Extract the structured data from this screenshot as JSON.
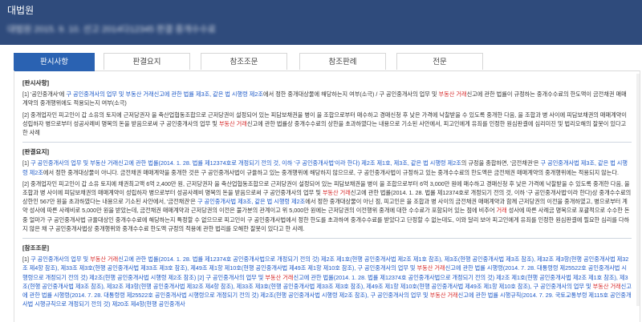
{
  "header": {
    "title": "대법원",
    "subtitle": "대법원 2015. 9. 10. 선고 2014다12345 판결 중개수수료"
  },
  "tabs": [
    {
      "label": "판시사항",
      "active": true
    },
    {
      "label": "판결요지",
      "active": false
    },
    {
      "label": "참조조문",
      "active": false
    },
    {
      "label": "참조판례",
      "active": false
    },
    {
      "label": "전문",
      "active": false
    }
  ],
  "sections": {
    "s1": {
      "title": "[판시사항]",
      "p1": [
        "[1] '공인중개사'에 ",
        "구 공인중개사의 업무 및 부동산 거래신고에 관한 법률 제3조, 같은 법 시행령 제2조",
        "에서 정한 중개대상물에 해당하는지 여부(소극) / 구 공인중개사의 업무 및 ",
        "부동산 거래",
        "신고에 관한 법률이 규정하는 중개수수료의 한도액이 금전채권 매매계약의 중개행위에도 적용되는지 여부(소극)"
      ],
      "p2": [
        "[2] 중개업자인 피고인이 갑 소유의 토지에 근저당권자 을 축산업협동조합으로 근저당권이 설정되어 있는 피담보채권을 병이 을 조합으로부터 매수하고 경매신청 후 낮은 가격에 낙찰받을 수 있도록 중개한 다음, 을 조합과 병 사이에 피담보채권의 매매계약이 성립하자 병으로부터 성공사례비 명목의 돈을 받음으로써 구 공인중개사의 업무 및 ",
        "부동산 거래",
        "신고에 관한 법률상 중개수수료의 상한을 초과하였다는 내용으로 기소된 사안에서, 피고인에게 유죄를 인정한 원심판결에 심리미진 및 법리오해의 잘못이 있다고 한 사례"
      ]
    },
    "s2": {
      "title": "[판결요지]",
      "p1": [
        "[1] ",
        "구 공인중개사의 업무 및 부동산 거래신고에 관한 법률(2014. 1. 28. 법률 제12374호로 개정되기 전의 것, 이하 '구 공인중개사법'이라 한다) 제2조 제1호, 제3조, 같은 법 시행령 제2조",
        "의 규정을 종합하면, '금전채권'은 ",
        "구 공인중개사법 제3조, 같은 법 시행령 제2조",
        "에서 정한 중개대상물이 아니다. 금전채권 매매계약을 중개한 것은 구 공인중개사법이 규율하고 있는 중개행위에 해당하지 않으므로, 구 공인중개사법이 규정하고 있는 중개수수료의 한도액은 금전채권 매매계약의 중개행위에는 적용되지 않는다."
      ],
      "p2": [
        "[2] 중개업자인 피고인이 갑 소유 토지에 채권최고액 6억 2,400만 원, 근저당권자 을 축산업협동조합으로 근저당권이 설정되어 있는 피담보채권을 병이 을 조합으로부터 6억 3,000만 원에 매수하고 경매신청 후 낮은 가격에 낙찰받을 수 있도록 중개한 다음, 을 조합과 병 사이에 피담보채권의 매매계약이 성립하자 병으로부터 성공사례비 명목의 돈을 받음으로써 구 공인중개사의 업무 및 ",
        "부동산 거래",
        "신고에 관한 법률(2014. 1. 28. 법률 제12374호로 개정되기 전의 것, 이하 '구 공인중개사법'이라 한다)상 중개수수료의 상한인 567만 원을 초과하였다는 내용으로 기소된 사안에서, '금전채권'은 ",
        "구 공인중개사법 제3조, 같은 법 시행령 제2조",
        "에서 정한 중개대상물이 아닌 점, 피고인은 을 조합과 병 사이의 금전채권 매매계약과 함께 근저당권의 이전을 중개하였고, 병으로부터 계약 성사에 따른 사례비로 5,000만 원을 받았는데, 금전채권 매매계약과 근저당권의 이전은 불가분의 관계이고 위 5,000만 원에는 근저당권의 이전행위 중개에 대한 수수료가 포함되어 있는 점에 비추어 ",
        "거래",
        " 성사에 따른 사례금 명목으로 포괄적으로 수수한 돈 중 얼마가 구 공인중개사법 규율대상인 중개수수료에 해당하는지 특정할 수 없으므로 피고인이 구 공인중개사법에서 정한 한도를 초과하여 중개수수료를 받았다고 단정할 수 없는데도, 이와 달리 보아 피고인에게 유죄를 인정한 원심판결에 필요한 심리를 다하지 않은 채 구 공인중개사법상 중개행위와 중개수수료 한도액 규정의 적용에 관한 법리를 오해한 잘못이 있다고 한 사례."
      ]
    },
    "s3": {
      "title": "[참조조문]",
      "p1": [
        "[1] ",
        "구 공인중개사의 업무 및 ",
        "부동산 거래",
        "신고에 관한 법률(2014. 1. 28. 법률 제12374호 공인중개사법으로 개정되기 전의 것) 제2조 제1호(현행 공인중개사법 제2조 제1호 참조), 제3조(현행 공인중개사법 제3조 참조), 제32조 제3항(현행 공인중개사법 제32조 제4항 참조), 제33조 제3호(현행 공인중개사법 제33조 제3호 참조), 제49조 제1항 제10호(현행 공인중개사법 제49조 제1항 제10호 참조), 구 공인중개사의 업무 및 ",
        "부동산 거래",
        "신고에 관한 법률 시행령(2014. 7. 28. 대통령령 제25522호 공인중개사법 시행령으로 개정되기 전의 것) 제2조(현행 공인중개사법 시행령 제2조 참조) [2] 구 공인중개사의 업무 및 ",
        "부동산 거래",
        "신고에 관한 법률(2014. 1. 28. 법률 제12374호 공인중개사법으로 개정되기 전의 것) 제2조 제1호(현행 공인중개사법 제2조 제1호 참조), 제3조(현행 공인중개사법 제3조 참조), 제32조 제3항(현행 공인중개사법 제32조 제4항 참조), 제33조 제3호(현행 공인중개사법 제33조 제3호 참조), 제49조 제1항 제10호(현행 공인중개사법 제49조 제1항 제10호 참조), 구 공인중개사의 업무 및 ",
        "부동산 거래",
        "신고에 관한 법률 시행령(2014. 7. 28. 대통령령 제25522호 공인중개사법 시행령으로 개정되기 전의 것) 제2조(현행 공인중개사법 시행령 제2조 참조), 구 공인중개사의 업무 및 ",
        "부동산 거래",
        "신고에 관한 법률 시행규칙(2014. 7. 29. 국토교통부령 제115호 공인중개사법 시행규칙으로 개정되기 전의 것) 제20조 제4항(현행 공인중개사"
      ]
    }
  },
  "colors": {
    "header_bg": "#2f4b7c",
    "tab_active": "#2a62b2",
    "link": "#1a57c7",
    "highlight": "#d72b2b"
  }
}
